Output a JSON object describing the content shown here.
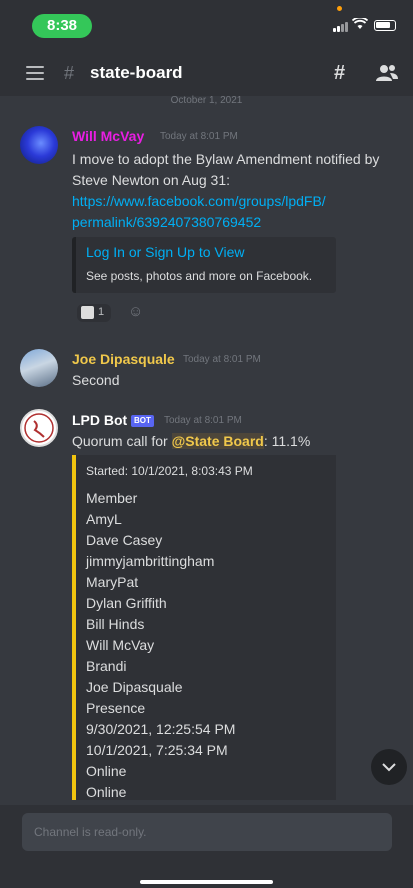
{
  "status_bar": {
    "time": "8:38"
  },
  "header": {
    "channel": "state-board",
    "hash": "#"
  },
  "date_separator": "October 1, 2021",
  "messages": [
    {
      "author": "Will McVay",
      "author_color": "#e91ee3",
      "timestamp": "Today at 8:01 PM",
      "text_line1": "I move to adopt the Bylaw Amendment notified by",
      "text_line2": "Steve Newton on Aug 31:",
      "link_line1": "https://www.facebook.com/groups/lpdFB/",
      "link_line2": "permalink/6392407380769452",
      "embed": {
        "title": "Log In or Sign Up to View",
        "description": "See posts, photos and more on Facebook."
      },
      "reaction_count": "1"
    },
    {
      "author": "Joe Dipasquale",
      "author_color": "#f0c84b",
      "timestamp": "Today at 8:01 PM",
      "text": "Second"
    },
    {
      "author": "LPD Bot",
      "author_color": "#ffffff",
      "bot_tag": "BOT",
      "timestamp": "Today at 8:01 PM",
      "text_prefix": "Quorum call for ",
      "mention": "@State Board",
      "text_suffix": ": 11.1%",
      "quorum": {
        "started": "Started: 10/1/2021, 8:03:43 PM",
        "lines": [
          "Member",
          "AmyL",
          "Dave Casey",
          "jimmyjambrittingham",
          "MaryPat",
          "Dylan Griffith",
          "Bill Hinds",
          "Will McVay",
          "Brandi",
          "Joe Dipasquale",
          "Presence",
          "9/30/2021, 12:25:54 PM",
          "10/1/2021, 7:25:34 PM",
          "Online",
          "Online"
        ]
      }
    }
  ],
  "footer": {
    "placeholder": "Channel is read-only."
  },
  "icons": {
    "menu": "hamburger-icon",
    "threads": "threads-icon",
    "members": "members-icon",
    "scroll_down": "chevron-down-icon"
  },
  "colors": {
    "background": "#36393f",
    "panel": "#2f3136",
    "link": "#00aff4",
    "quorum_accent": "#f1c40f",
    "bot_tag": "#5865f2"
  }
}
